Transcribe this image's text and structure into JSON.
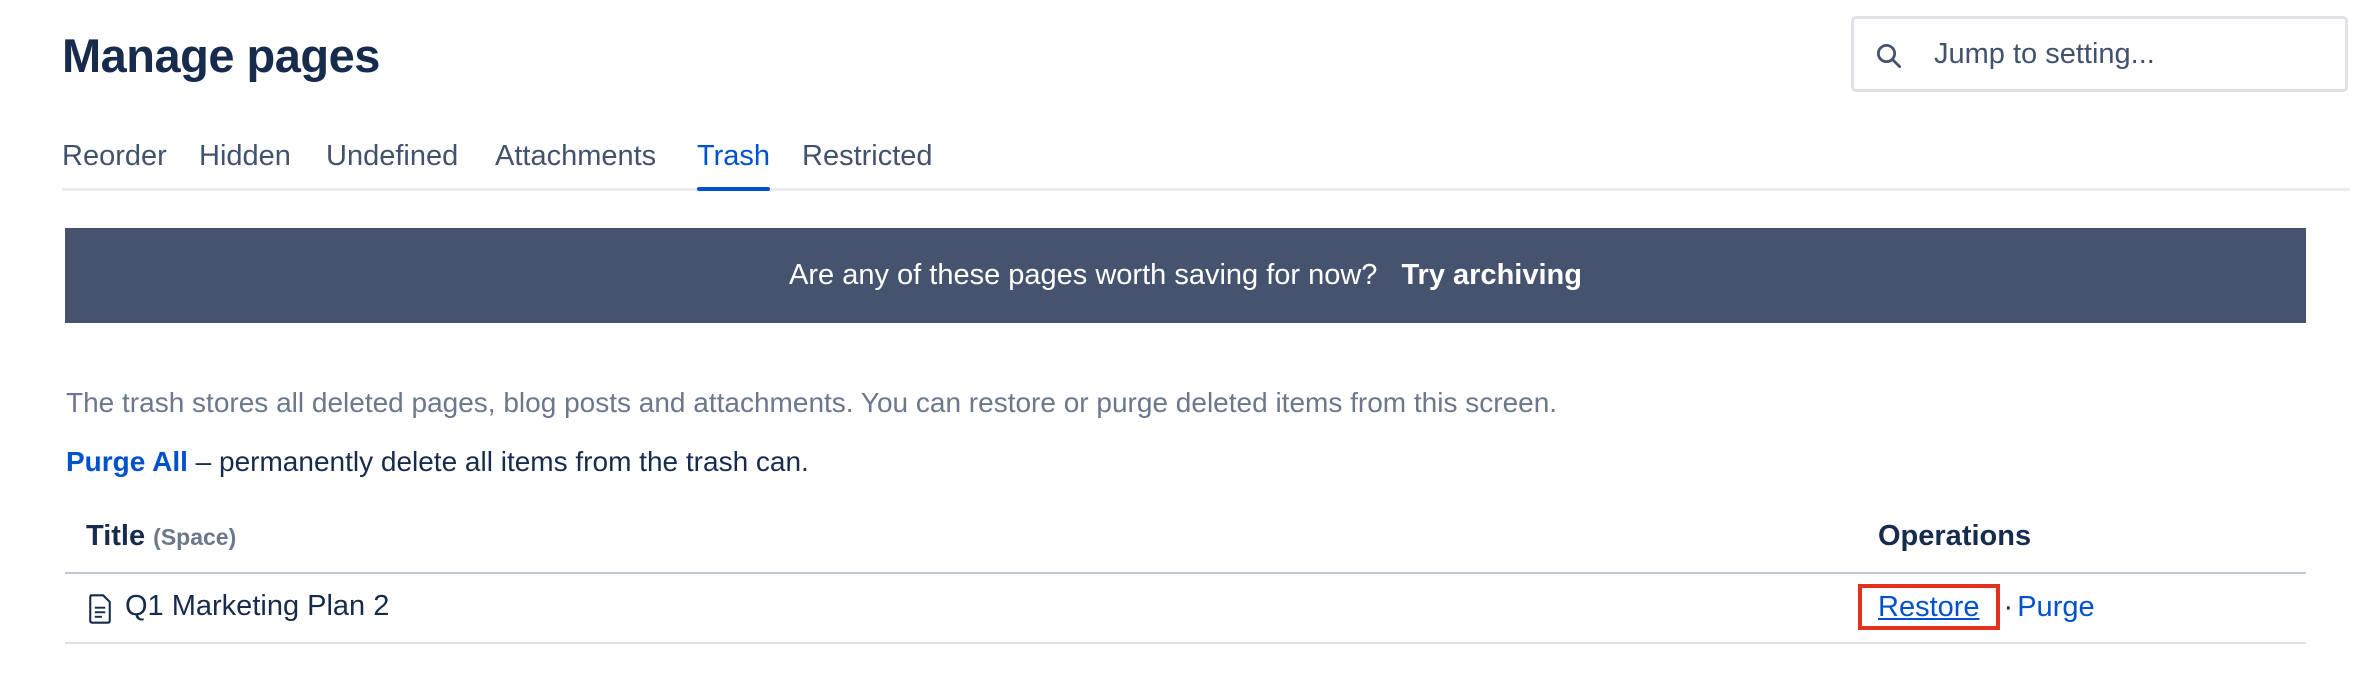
{
  "header": {
    "title": "Manage pages"
  },
  "search": {
    "placeholder": "Jump to setting...",
    "icon": "search-icon"
  },
  "tabs": [
    {
      "label": "Reorder",
      "active": false
    },
    {
      "label": "Hidden",
      "active": false
    },
    {
      "label": "Undefined",
      "active": false
    },
    {
      "label": "Attachments",
      "active": false
    },
    {
      "label": "Trash",
      "active": true
    },
    {
      "label": "Restricted",
      "active": false
    }
  ],
  "banner": {
    "text": "Are any of these pages worth saving for now?",
    "link": "Try archiving"
  },
  "description": "The trash stores all deleted pages, blog posts and attachments. You can restore or purge deleted items from this screen.",
  "purge_all": {
    "link": "Purge All",
    "text": " – permanently delete all items from the trash can."
  },
  "table": {
    "headers": {
      "title": "Title",
      "space": "(Space)",
      "operations": "Operations"
    },
    "rows": [
      {
        "title": "Q1 Marketing Plan 2",
        "icon": "page-icon",
        "restore": "Restore",
        "separator": "·",
        "purge": "Purge"
      }
    ]
  },
  "colors": {
    "link": "#0052cc",
    "banner_bg": "#45536e",
    "highlight_box": "#e0321f"
  }
}
